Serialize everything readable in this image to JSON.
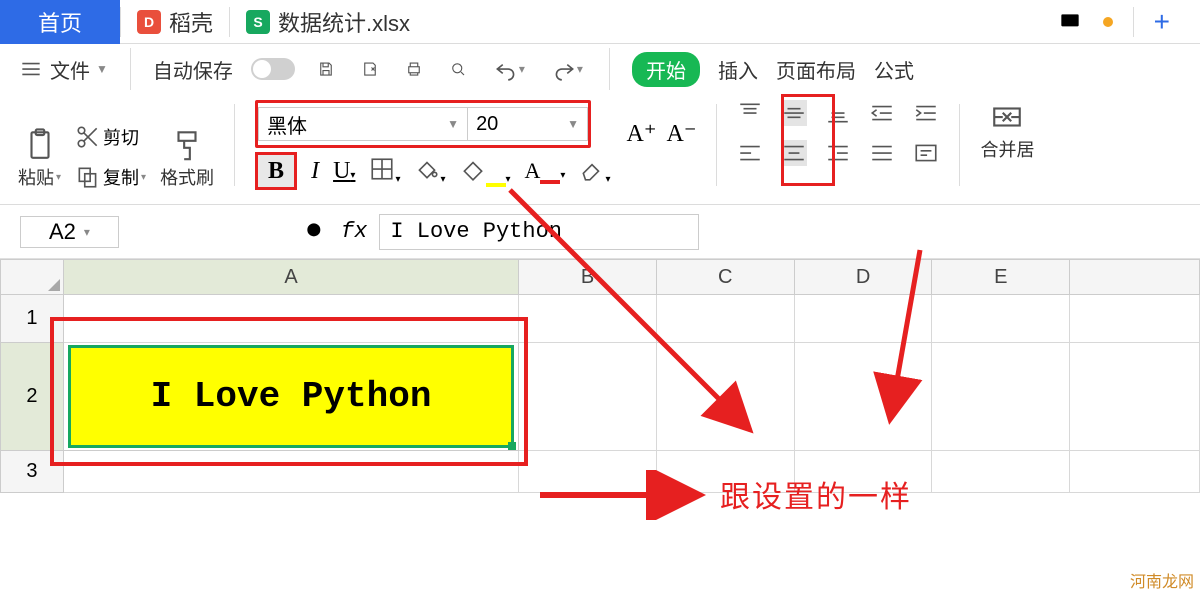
{
  "tabs": {
    "home": "首页",
    "docer": "稻壳",
    "file": "数据统计.xlsx",
    "plus": "+"
  },
  "toolbar1": {
    "file_menu": "文件",
    "autosave": "自动保存",
    "ribbon_start": "开始",
    "ribbon_insert": "插入",
    "ribbon_layout": "页面布局",
    "ribbon_formula": "公式"
  },
  "clipboard": {
    "cut": "剪切",
    "copy": "复制",
    "paste": "粘贴",
    "format_painter": "格式刷"
  },
  "font": {
    "name": "黑体",
    "size": "20",
    "bold": "B",
    "increase": "A⁺",
    "decrease": "A⁻"
  },
  "merge": {
    "label": "合并居"
  },
  "refbar": {
    "cell": "A2",
    "fx": "fx",
    "formula": "I Love Python"
  },
  "grid": {
    "cols": [
      "A",
      "B",
      "C",
      "D",
      "E"
    ],
    "rows": [
      "1",
      "2",
      "3"
    ],
    "a2_value": "I Love Python"
  },
  "annotation": "跟设置的一样",
  "watermark": "河南龙网"
}
